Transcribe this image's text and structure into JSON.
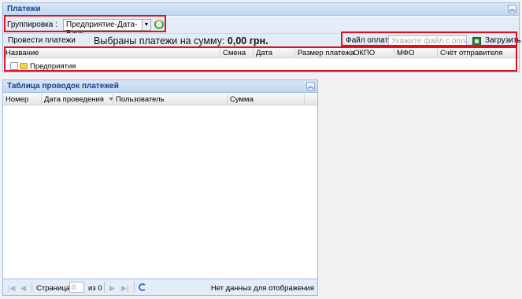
{
  "payments_panel": {
    "title": "Платежи",
    "grouping_label": "Группировка :",
    "grouping_value": "Предприятие-Дата-Банк",
    "process_button": "Провести платежи",
    "selected_sum_text": "Выбраны платежи на сумму:",
    "selected_sum_value": "0,00 грн.",
    "file_label": "Файл оплат:",
    "file_placeholder": "Укажите файл с оплатами",
    "upload_button": "Загрузить",
    "columns": [
      "Название",
      "Смена",
      "Дата",
      "Размер платежа",
      "ОКПО",
      "МФО",
      "Счёт отправителя"
    ],
    "tree_root": "Предприятия"
  },
  "postings_panel": {
    "title": "Таблица проводок платежей",
    "columns": [
      "Номер",
      "Дата проведения",
      "Пользователь",
      "Сумма"
    ],
    "paging": {
      "page_label": "Страница",
      "page_value": "0",
      "of_label": "из 0",
      "empty_text": "Нет данных для отображения"
    }
  },
  "icons": [
    "collapse-icon",
    "chevron-down-icon",
    "refresh-icon",
    "excel-file-icon",
    "checkbox-icon",
    "folder-icon",
    "first-page-icon",
    "prev-page-icon",
    "next-page-icon",
    "last-page-icon",
    "sort-desc-icon"
  ],
  "colors": {
    "highlight": "#e0101c",
    "panel_border": "#99bbe8",
    "title": "#15428b"
  }
}
